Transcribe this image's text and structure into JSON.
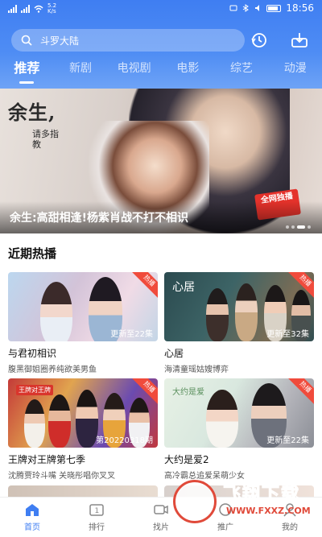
{
  "status_bar": {
    "time": "18:56",
    "speed": "5.2 K/s"
  },
  "search": {
    "placeholder": "斗罗大陆"
  },
  "tabs": [
    {
      "label": "推荐",
      "active": true
    },
    {
      "label": "新剧"
    },
    {
      "label": "电视剧"
    },
    {
      "label": "电影"
    },
    {
      "label": "综艺"
    },
    {
      "label": "动漫"
    }
  ],
  "banner": {
    "logo_main": "余生,",
    "logo_sub": "请多指教",
    "caption": "余生:高甜相逢!杨紫肖战不打不相识",
    "badge": "全网独播"
  },
  "section": {
    "title": "近期热播"
  },
  "cards": [
    {
      "title": "与君初相识",
      "subtitle": "腹黑御姐圈养纯欲美男鱼",
      "update": "更新至22集",
      "tag": "热播",
      "thumb_text": ""
    },
    {
      "title": "心居",
      "subtitle": "海清童瑶姑嫂博弈",
      "update": "更新至32集",
      "tag": "热播",
      "thumb_text": "心居"
    },
    {
      "title": "王牌对王牌第七季",
      "subtitle": "沈腾贾玲斗嘴 关晓彤唱你叉叉",
      "update": "第20220318期",
      "tag": "热播",
      "thumb_text": "王牌对王牌"
    },
    {
      "title": "大约是爱2",
      "subtitle": "高冷霸总追爱呆萌少女",
      "update": "更新至22集",
      "tag": "热播",
      "thumb_text": "大约是爱"
    }
  ],
  "bottom_nav": [
    {
      "label": "首页",
      "icon": "home-icon",
      "active": true
    },
    {
      "label": "排行",
      "icon": "ranking-icon"
    },
    {
      "label": "找片",
      "icon": "find-video-icon"
    },
    {
      "label": "推广",
      "icon": "promote-icon"
    },
    {
      "label": "我的",
      "icon": "profile-icon"
    }
  ],
  "watermark": {
    "main": "飞翔下载",
    "sub": "WWW.FXXZ.COM"
  },
  "colors": {
    "accent": "#3f7ef2",
    "hot_tag": "#f04b3c",
    "badge": "#e4322b"
  }
}
